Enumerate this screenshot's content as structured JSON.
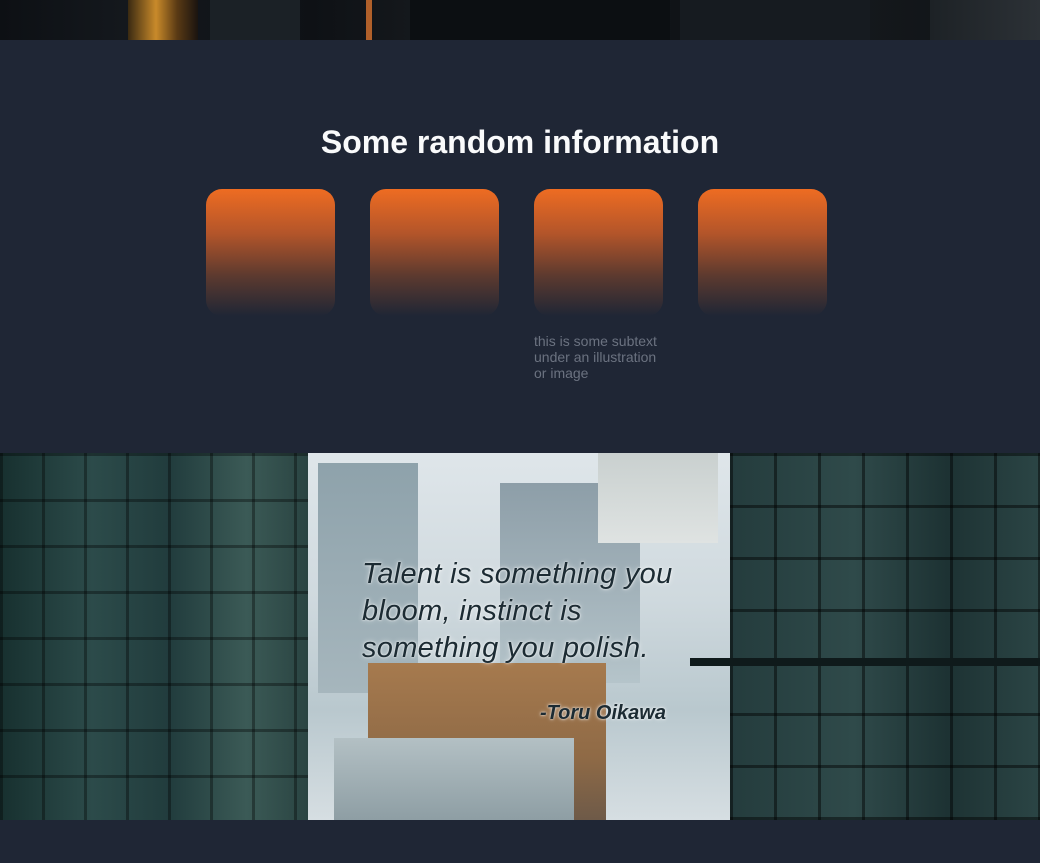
{
  "info": {
    "title": "Some random information",
    "tile_subtext": "this is some subtext under an illustration or image"
  },
  "quote": {
    "text": "Talent is something you bloom, instinct is something you polish.",
    "author": "-Toru Oikawa"
  },
  "colors": {
    "background": "#1f2635",
    "accent_orange": "#ee6c22",
    "subtext": "#6b7280"
  }
}
